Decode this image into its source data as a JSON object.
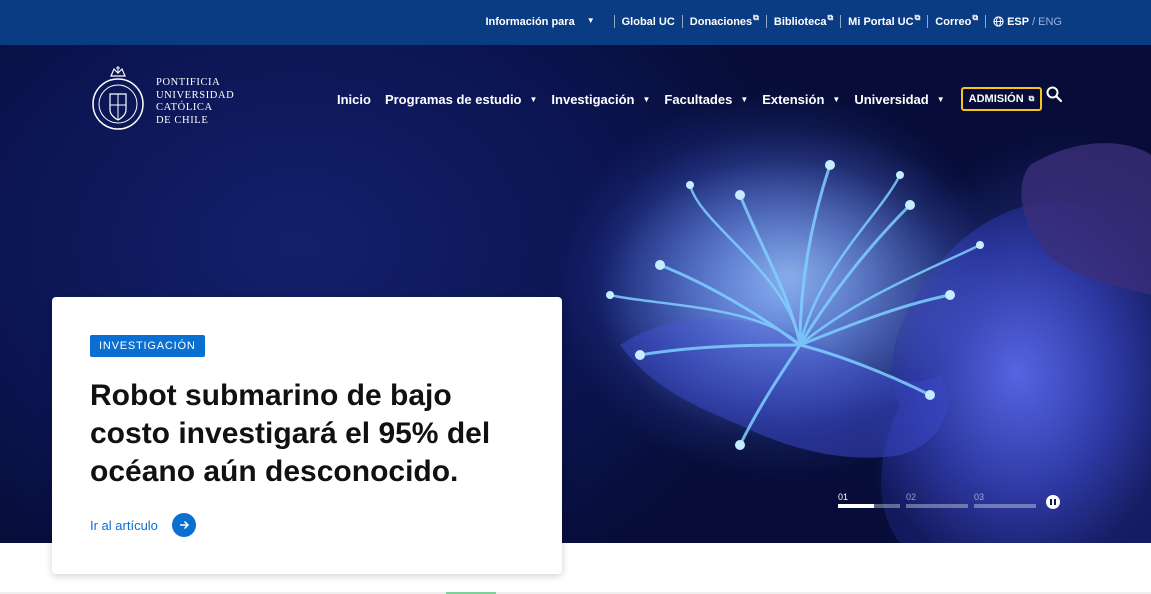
{
  "topbar": {
    "info_for": "Información para",
    "links": [
      "Global UC",
      "Donaciones",
      "Biblioteca",
      "Mi Portal UC",
      "Correo"
    ],
    "lang_active": "ESP",
    "lang_sep": "/",
    "lang_other": "ENG"
  },
  "logo": {
    "lines": [
      "PONTIFICIA",
      "UNIVERSIDAD",
      "CATÓLICA",
      "DE CHILE"
    ]
  },
  "nav": {
    "items": [
      "Inicio",
      "Programas de estudio",
      "Investigación",
      "Facultades",
      "Extensión",
      "Universidad"
    ],
    "admission": "ADMISIÓN"
  },
  "card": {
    "category": "INVESTIGACIÓN",
    "headline": "Robot submarino de bajo costo investigará el 95% del océano aún desconocido.",
    "cta": "Ir al artículo"
  },
  "slider": {
    "slides": [
      "01",
      "02",
      "03"
    ],
    "active_index": 0,
    "progress": 0.58
  },
  "colors": {
    "topbar": "#0a3c84",
    "accent_blue": "#0a6fd0",
    "admission_border": "#f5c518"
  }
}
